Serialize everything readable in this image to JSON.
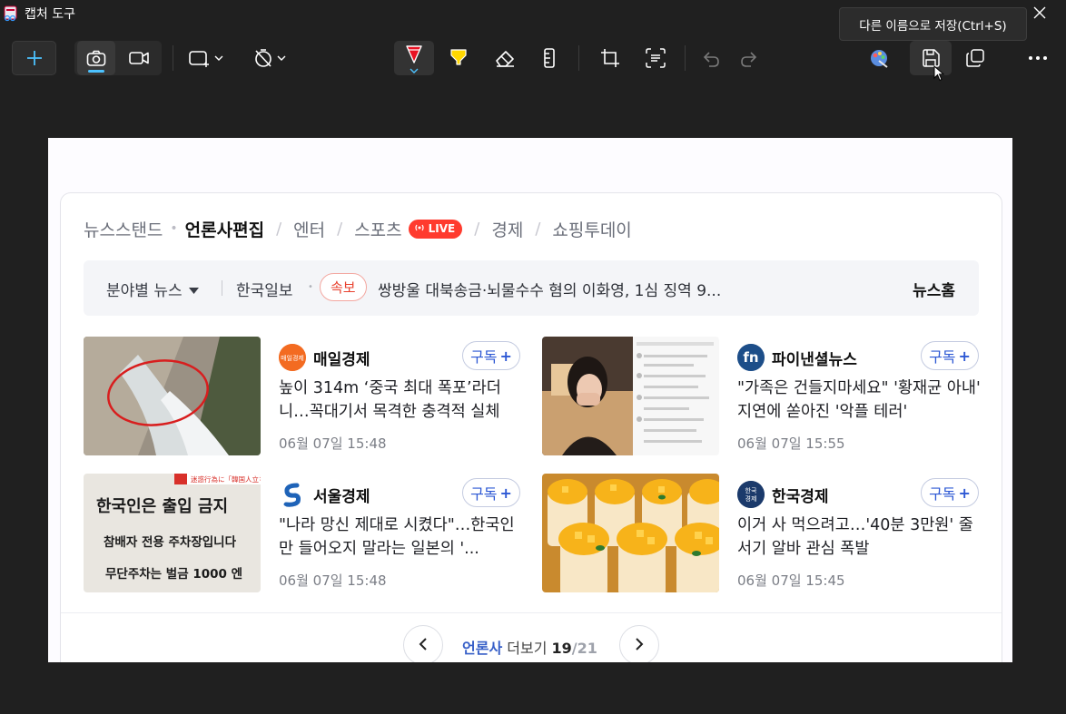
{
  "window": {
    "title": "캡처 도구",
    "close_icon": "close-icon"
  },
  "tooltip": {
    "text": "다른 이름으로 저장(Ctrl+S)"
  },
  "toolbar": {
    "new_icon": "plus-icon",
    "photo_icon": "camera-icon",
    "video_icon": "video-icon",
    "shape_icon": "rectangle-snip-icon",
    "timer_icon": "no-timer-icon",
    "pen_icon": "ballpoint-pen-icon",
    "highlighter_icon": "highlighter-icon",
    "eraser_icon": "eraser-icon",
    "ruler_icon": "ruler-icon",
    "crop_icon": "crop-icon",
    "text_actions_icon": "text-actions-icon",
    "undo_icon": "undo-icon",
    "redo_icon": "redo-icon",
    "paint_icon": "paint-3d-icon",
    "save_icon": "save-icon",
    "copy_icon": "copy-icon",
    "more_icon": "more-icon",
    "accent_color": "#4cc2ff",
    "pen_color": "#e81123",
    "highlighter_color": "#ffd700"
  },
  "news": {
    "tabs": [
      {
        "label": "뉴스스탠드"
      },
      {
        "label": "언론사편집"
      },
      {
        "label": "엔터"
      },
      {
        "label": "스포츠"
      },
      {
        "label": "경제"
      },
      {
        "label": "쇼핑투데이"
      }
    ],
    "live_badge": "LIVE",
    "ticker": {
      "category": "분야별 뉴스",
      "press": "한국일보",
      "breaking": "속보",
      "headline": "쌍방울 대북송금·뇌물수수 혐의 이화영, 1심 징역 9...",
      "home": "뉴스홈"
    },
    "subscribe_label": "구독",
    "articles": [
      {
        "press": "매일경제",
        "logo_text": "매일경제",
        "title": "높이 314m ‘중국 최대 폭포’라더니…꼭대기서 목격한 충격적 실체",
        "time": "06월 07일 15:48"
      },
      {
        "press": "파이낸셜뉴스",
        "logo_text": "fn",
        "title": "\"가족은 건들지마세요\" '황재균 아내' 지연에 쏟아진 '악플 테러'",
        "time": "06월 07일 15:55"
      },
      {
        "press": "서울경제",
        "logo_text": "S",
        "title": "\"나라 망신 제대로 시켰다\"…한국인만 들어오지 말라는 일본의 '...",
        "time": "06월 07일 15:48"
      },
      {
        "press": "한국경제",
        "logo_text": "한국경제",
        "title": "이거 사 먹으려고…'40분 3만원' 줄서기 알바 관심 폭발",
        "time": "06월 07일 15:45"
      }
    ],
    "thumb3_lines": [
      "한국인은 출입 금지",
      "참배자 전용 주차장입니다",
      "무단주차는 벌금 1000 엔",
      "迷惑行為に「韓国人立ち入り"
    ],
    "pager": {
      "label_accent": "언론사",
      "label": "더보기",
      "current": "19",
      "total": "/21"
    }
  }
}
